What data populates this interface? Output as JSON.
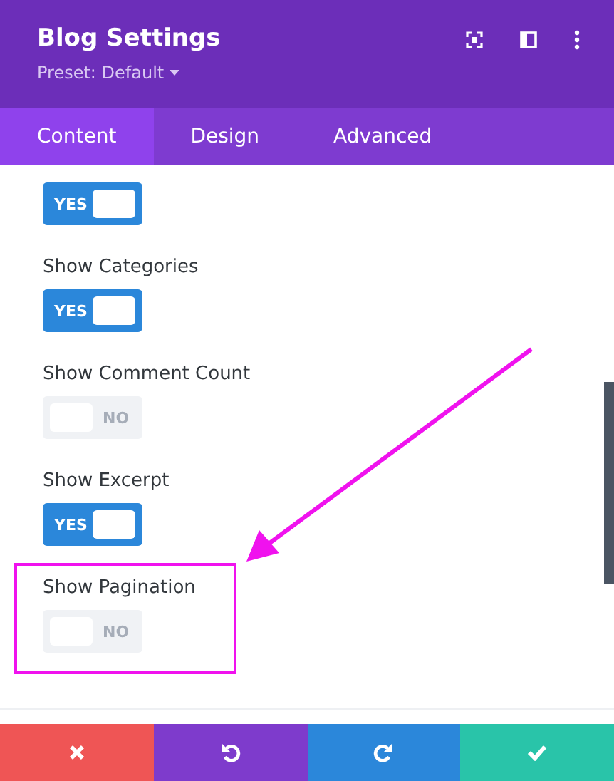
{
  "header": {
    "title": "Blog Settings",
    "preset": "Preset: Default"
  },
  "tabs": [
    {
      "label": "Content",
      "selected": true
    },
    {
      "label": "Design",
      "selected": false
    },
    {
      "label": "Advanced",
      "selected": false
    }
  ],
  "settings": [
    {
      "on": true,
      "state_label": "YES",
      "highlighted": false
    },
    {
      "label": "Show Categories",
      "on": true,
      "state_label": "YES",
      "highlighted": false
    },
    {
      "label": "Show Comment Count",
      "on": false,
      "state_label": "NO",
      "highlighted": false
    },
    {
      "label": "Show Excerpt",
      "on": true,
      "state_label": "YES",
      "highlighted": false
    },
    {
      "label": "Show Pagination",
      "on": false,
      "state_label": "NO",
      "highlighted": true
    }
  ],
  "footer": [
    {
      "kind": "cancel"
    },
    {
      "kind": "undo"
    },
    {
      "kind": "redo"
    },
    {
      "kind": "save"
    }
  ]
}
